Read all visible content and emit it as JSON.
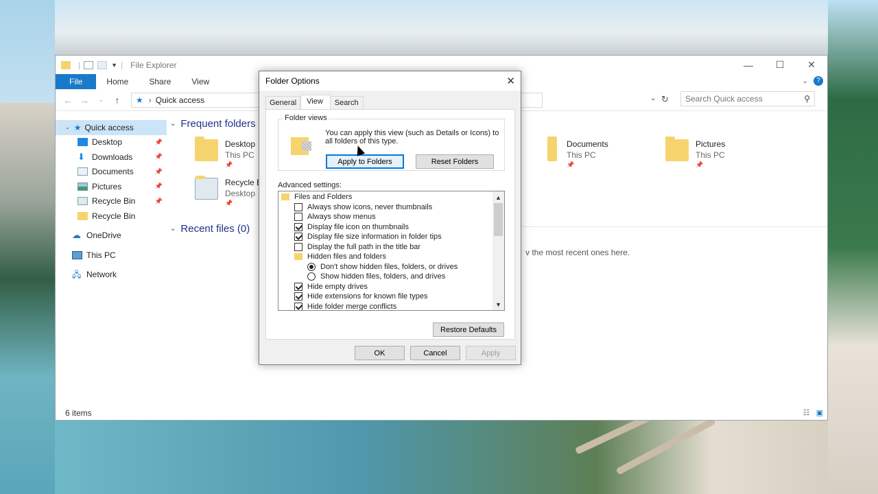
{
  "explorer": {
    "title": "File Explorer",
    "ribbon_tabs": [
      "File",
      "Home",
      "Share",
      "View"
    ],
    "address": "Quick access",
    "search_placeholder": "Search Quick access",
    "nav": {
      "quick_access": "Quick access",
      "items": [
        {
          "label": "Desktop",
          "icon": "desktop-icon"
        },
        {
          "label": "Downloads",
          "icon": "download-icon"
        },
        {
          "label": "Documents",
          "icon": "documents-icon"
        },
        {
          "label": "Pictures",
          "icon": "pictures-icon"
        },
        {
          "label": "Recycle Bin",
          "icon": "recycle-bin-icon"
        },
        {
          "label": "Recycle Bin",
          "icon": "folder-icon"
        }
      ],
      "onedrive": "OneDrive",
      "this_pc": "This PC",
      "network": "Network"
    },
    "frequent_header": "Frequent folders (",
    "frequent": [
      {
        "name": "Desktop",
        "location": "This PC"
      },
      {
        "name": "Recycle B",
        "location": "Desktop"
      },
      {
        "name": "Documents",
        "location": "This PC"
      },
      {
        "name": "Pictures",
        "location": "This PC"
      }
    ],
    "recent_header": "Recent files (0)",
    "recent_message": "v the most recent ones here.",
    "status": "6 items"
  },
  "dialog": {
    "title": "Folder Options",
    "tabs": [
      "General",
      "View",
      "Search"
    ],
    "folder_views_label": "Folder views",
    "folder_views_text": "You can apply this view (such as Details or Icons) to all folders of this type.",
    "apply_folders": "Apply to Folders",
    "reset_folders": "Reset Folders",
    "advanced_label": "Advanced settings:",
    "settings": [
      {
        "type": "folder",
        "label": "Files and Folders"
      },
      {
        "type": "check",
        "checked": false,
        "label": "Always show icons, never thumbnails"
      },
      {
        "type": "check",
        "checked": false,
        "label": "Always show menus"
      },
      {
        "type": "check",
        "checked": true,
        "label": "Display file icon on thumbnails"
      },
      {
        "type": "check",
        "checked": true,
        "label": "Display file size information in folder tips"
      },
      {
        "type": "check",
        "checked": false,
        "label": "Display the full path in the title bar"
      },
      {
        "type": "folder",
        "label": "Hidden files and folders"
      },
      {
        "type": "radio",
        "checked": true,
        "label": "Don't show hidden files, folders, or drives"
      },
      {
        "type": "radio",
        "checked": false,
        "label": "Show hidden files, folders, and drives"
      },
      {
        "type": "check",
        "checked": true,
        "label": "Hide empty drives"
      },
      {
        "type": "check",
        "checked": true,
        "label": "Hide extensions for known file types"
      },
      {
        "type": "check",
        "checked": true,
        "label": "Hide folder merge conflicts"
      }
    ],
    "restore_defaults": "Restore Defaults",
    "ok": "OK",
    "cancel": "Cancel",
    "apply": "Apply"
  }
}
